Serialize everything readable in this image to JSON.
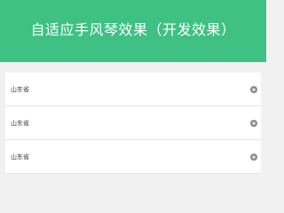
{
  "header": {
    "title": "自适应手风琴效果（开发效果）",
    "bg_color": "#3ec183"
  },
  "accordion": {
    "items": [
      {
        "label": "山东省",
        "icon": "plus-circle-icon"
      },
      {
        "label": "山东省",
        "icon": "plus-circle-icon"
      },
      {
        "label": "山东省",
        "icon": "plus-circle-icon"
      }
    ]
  }
}
